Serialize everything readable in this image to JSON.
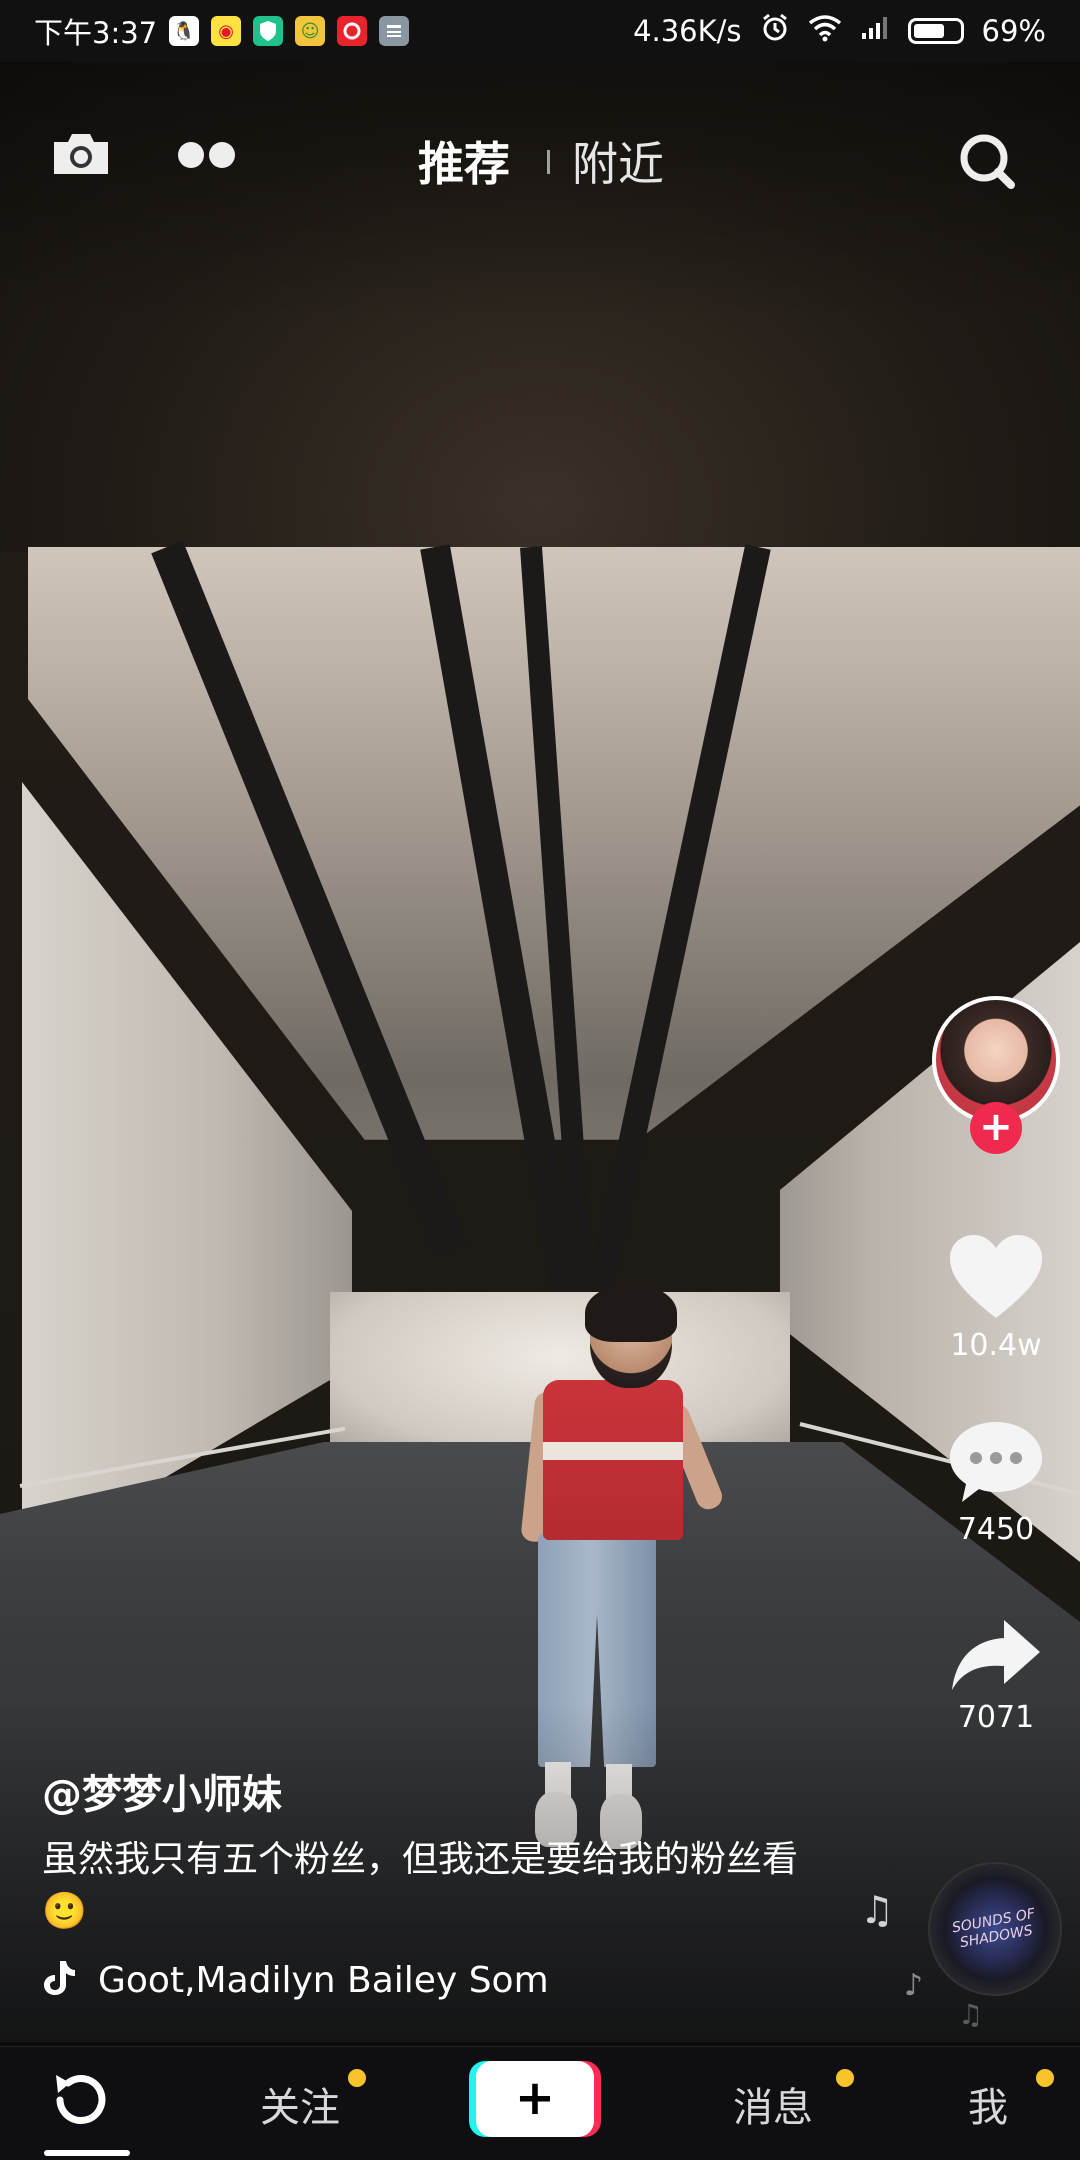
{
  "status_bar": {
    "time": "下午3:37",
    "network_speed": "4.36K/s",
    "battery_percent": "69%",
    "battery_level": 0.69,
    "app_icons": [
      "qq-icon",
      "weibo-icon",
      "shield-icon",
      "game-icon",
      "netease-music-icon",
      "calculator-icon"
    ]
  },
  "top_nav": {
    "tabs": [
      {
        "label": "推荐",
        "active": true
      },
      {
        "label": "附近",
        "active": false
      }
    ]
  },
  "video": {
    "author": "@梦梦小师妹",
    "caption": "虽然我只有五个粉丝，但我还是要给我的粉丝看",
    "caption_emoji": "🙂",
    "music": "Goot,Madilyn Bailey    Som",
    "disc_label": "SOUNDS OF SHADOWS"
  },
  "actions": {
    "likes": "10.4w",
    "comments": "7450",
    "shares": "7071"
  },
  "bottom_nav": {
    "items": [
      {
        "label": "关注",
        "badge": true
      },
      {
        "label": "消息",
        "badge": true
      },
      {
        "label": "我",
        "badge": true
      }
    ],
    "create_label": "+"
  },
  "colors": {
    "accent_red": "#f0294f",
    "badge_yellow": "#f7c52b",
    "tiktok_cyan": "#25f4ee",
    "tiktok_pink": "#fe2c55"
  }
}
